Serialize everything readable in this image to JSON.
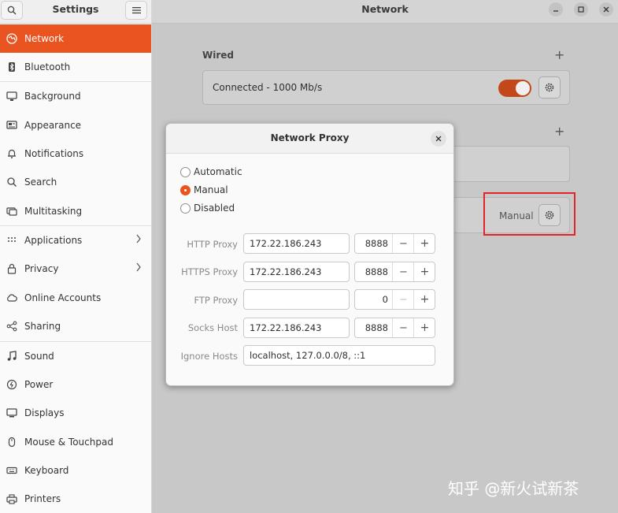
{
  "sidebar": {
    "title": "Settings",
    "items": [
      {
        "label": "Network",
        "icon": "network-icon"
      },
      {
        "label": "Bluetooth",
        "icon": "bluetooth-icon"
      },
      {
        "label": "Background",
        "icon": "background-icon"
      },
      {
        "label": "Appearance",
        "icon": "appearance-icon"
      },
      {
        "label": "Notifications",
        "icon": "bell-icon"
      },
      {
        "label": "Search",
        "icon": "search-icon"
      },
      {
        "label": "Multitasking",
        "icon": "multitasking-icon"
      },
      {
        "label": "Applications",
        "icon": "grid-icon"
      },
      {
        "label": "Privacy",
        "icon": "lock-icon"
      },
      {
        "label": "Online Accounts",
        "icon": "cloud-icon"
      },
      {
        "label": "Sharing",
        "icon": "share-icon"
      },
      {
        "label": "Sound",
        "icon": "music-note-icon"
      },
      {
        "label": "Power",
        "icon": "power-icon"
      },
      {
        "label": "Displays",
        "icon": "display-icon"
      },
      {
        "label": "Mouse & Touchpad",
        "icon": "mouse-icon"
      },
      {
        "label": "Keyboard",
        "icon": "keyboard-icon"
      },
      {
        "label": "Printers",
        "icon": "printer-icon"
      }
    ],
    "active_color": "#e95420"
  },
  "header": {
    "title": "Network"
  },
  "wired": {
    "section_title": "Wired",
    "status": "Connected - 1000 Mb/s",
    "enabled": true
  },
  "proxy_row": {
    "mode": "Manual"
  },
  "dialog": {
    "title": "Network Proxy",
    "modes": [
      "Automatic",
      "Manual",
      "Disabled"
    ],
    "selected_mode": "Manual",
    "fields": {
      "http": {
        "label": "HTTP Proxy",
        "host": "172.22.186.243",
        "port": "8888"
      },
      "https": {
        "label": "HTTPS Proxy",
        "host": "172.22.186.243",
        "port": "8888"
      },
      "ftp": {
        "label": "FTP Proxy",
        "host": "",
        "port": "0"
      },
      "socks": {
        "label": "Socks Host",
        "host": "172.22.186.243",
        "port": "8888"
      },
      "ignore": {
        "label": "Ignore Hosts",
        "value": "localhost, 127.0.0.0/8, ::1"
      }
    }
  },
  "watermark": "知乎 @新火试新茶"
}
